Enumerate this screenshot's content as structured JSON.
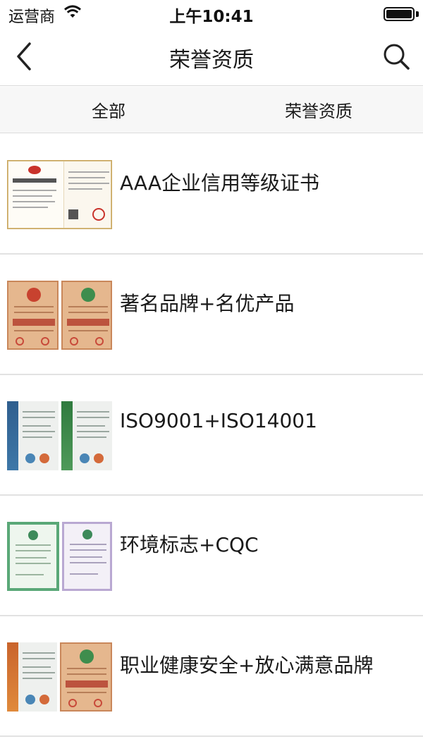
{
  "status_bar": {
    "carrier": "运营商",
    "time": "上午10:41",
    "battery_level": 1.0
  },
  "nav": {
    "title": "荣誉资质",
    "back_icon": "chevron-left-icon",
    "search_icon": "search-icon"
  },
  "tabs": [
    {
      "label": "全部"
    },
    {
      "label": "荣誉资质"
    }
  ],
  "items": [
    {
      "title": "AAA企业信用等级证书",
      "thumbnail": "certificate-thumbnail"
    },
    {
      "title": "著名品牌+名优产品",
      "thumbnail": "certificate-thumbnail"
    },
    {
      "title": "ISO9001+ISO14001",
      "thumbnail": "certificate-thumbnail"
    },
    {
      "title": "环境标志+CQC",
      "thumbnail": "certificate-thumbnail"
    },
    {
      "title": "职业健康安全+放心满意品牌",
      "thumbnail": "certificate-thumbnail"
    }
  ],
  "colors": {
    "accent_text": "#1a1a1a",
    "tab_bg": "#f7f7f7",
    "divider": "#e2e2e2"
  }
}
